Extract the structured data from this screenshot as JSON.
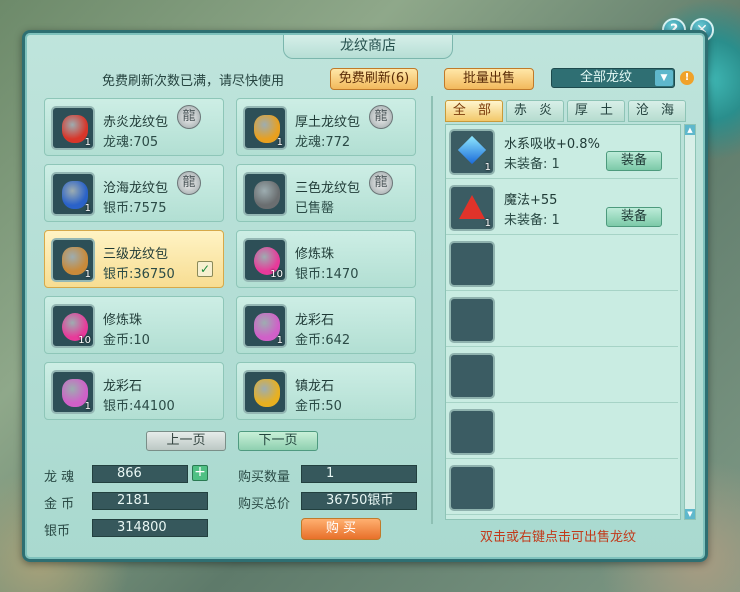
{
  "window": {
    "title": "龙纹商店"
  },
  "top_buttons": {
    "help": "?",
    "close": "✕"
  },
  "notice": "免费刷新次数已满，请尽快使用",
  "buttons": {
    "free_refresh": "免费刷新(6)",
    "batch_sell": "批量出售",
    "prev_page": "上一页",
    "next_page": "下一页",
    "buy": "购 买"
  },
  "filter": {
    "selected": "全部龙纹"
  },
  "shop_items": [
    {
      "name": "赤炎龙纹包",
      "price": "龙魂:705",
      "count": "1",
      "icon": "red-bag-icon",
      "color": "#d8362a",
      "has_badge": true
    },
    {
      "name": "厚土龙纹包",
      "price": "龙魂:772",
      "count": "1",
      "icon": "gold-bag-icon",
      "color": "#e8a020",
      "has_badge": true
    },
    {
      "name": "沧海龙纹包",
      "price": "银币:7575",
      "count": "1",
      "icon": "blue-bag-icon",
      "color": "#2a62c8",
      "has_badge": true
    },
    {
      "name": "三色龙纹包",
      "price": "已售罄",
      "count": "",
      "icon": "gray-bag-icon",
      "color": "#6a6e70",
      "has_badge": true
    },
    {
      "name": "三级龙纹包",
      "price": "银币:36750",
      "count": "1",
      "icon": "money-bag-icon",
      "color": "#c88a3a",
      "has_badge": false,
      "selected": true
    },
    {
      "name": "修炼珠",
      "price": "银币:1470",
      "count": "10",
      "icon": "pink-orb-icon",
      "color": "#e83a9a",
      "has_badge": false
    },
    {
      "name": "修炼珠",
      "price": "金币:10",
      "count": "10",
      "icon": "pink-orb-icon",
      "color": "#e83a9a",
      "has_badge": false
    },
    {
      "name": "龙彩石",
      "price": "金币:642",
      "count": "1",
      "icon": "crystal-icon",
      "color": "#d060c8",
      "has_badge": false
    },
    {
      "name": "龙彩石",
      "price": "银币:44100",
      "count": "1",
      "icon": "crystal-icon",
      "color": "#d060c8",
      "has_badge": false
    },
    {
      "name": "镇龙石",
      "price": "金币:50",
      "count": "",
      "icon": "gold-ingot-icon",
      "color": "#e8b020",
      "has_badge": false
    }
  ],
  "currency": {
    "dragon_soul_label": "龙  魂",
    "dragon_soul_value": "866",
    "gold_label": "金  币",
    "gold_value": "2181",
    "silver_label": "银币",
    "silver_value": "314800"
  },
  "purchase": {
    "qty_label": "购买数量",
    "qty_value": "1",
    "total_label": "购买总价",
    "total_value": "36750银币"
  },
  "tabs": [
    "全 部",
    "赤 炎",
    "厚 土",
    "沧 海"
  ],
  "owned_items": [
    {
      "name": "水系吸收+0.8%",
      "sub": "未装备: 1",
      "count": "1",
      "icon": "blue-diamond-icon",
      "equip": "装备"
    },
    {
      "name": "魔法+55",
      "sub": "未装备: 1",
      "count": "1",
      "icon": "red-triangle-icon",
      "equip": "装备"
    }
  ],
  "footer_hint": "双击或右键点击可出售龙纹"
}
